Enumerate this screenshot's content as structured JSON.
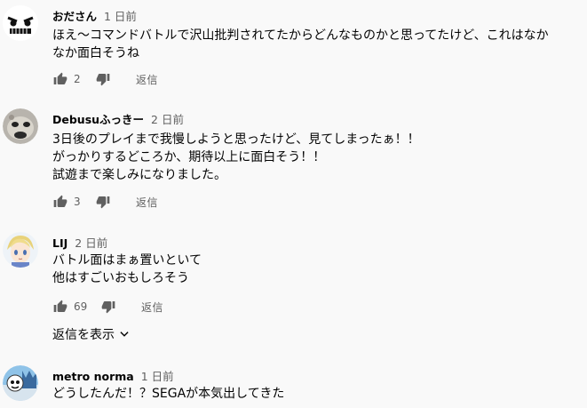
{
  "comments": [
    {
      "author": "おださん",
      "time": "1 日前",
      "lines": [
        "ほえ～コマンドバトルで沢山批判されてたからどんなものかと思ってたけど、これはなか",
        "なか面白そうね"
      ],
      "likes": "2",
      "reply_label": "返信"
    },
    {
      "author": "Debusuふっきー",
      "time": "2 日前",
      "lines": [
        "3日後のプレイまで我慢しようと思ったけど、見てしまったぁ！！",
        "がっかりするどころか、期待以上に面白そう！！",
        "試遊まで楽しみになりました。"
      ],
      "likes": "3",
      "reply_label": "返信"
    },
    {
      "author": "LIJ",
      "time": "2 日前",
      "lines": [
        "バトル面はまぁ置いといて",
        "他はすごいおもしろそう"
      ],
      "likes": "69",
      "reply_label": "返信",
      "show_replies_label": "返信を表示"
    },
    {
      "author": "metro norma",
      "time": "1 日前",
      "lines": [
        "どうしたんだ！？SEGAが本気出してきた"
      ]
    }
  ],
  "colors": {
    "icon": "#606060",
    "text": "#030303",
    "meta": "#606060"
  },
  "icons": {
    "like": "thumbs-up-icon",
    "dislike": "thumbs-down-icon",
    "expand": "chevron-down-icon"
  }
}
